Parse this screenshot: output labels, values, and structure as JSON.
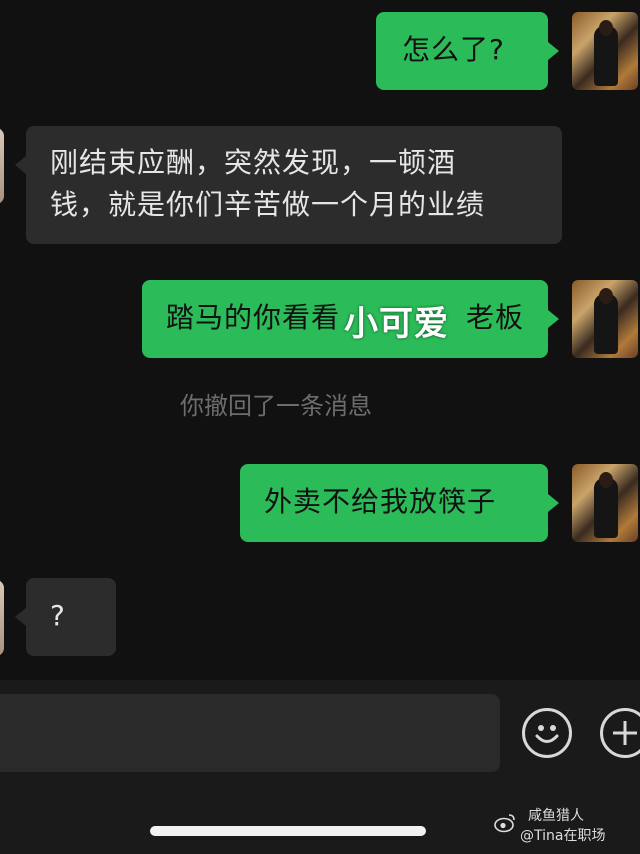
{
  "messages": [
    {
      "sender": "me",
      "text": "怎么了?"
    },
    {
      "sender": "them",
      "lines": [
        "刚结束应酬，突然发现，一顿酒",
        "钱，就是你们辛苦做一个月的业绩"
      ]
    },
    {
      "sender": "me",
      "text": "踏马的你看看",
      "text_tail": "老板"
    },
    {
      "sender": "me",
      "text": "外卖不给我放筷子"
    },
    {
      "sender": "them",
      "text": "?"
    }
  ],
  "overlay_text": "小可爱",
  "system_message": "你撤回了一条消息",
  "watermark": {
    "line1": "咸鱼猎人",
    "line2": "@Tina在职场"
  },
  "icons": {
    "emoji": "smiley-face-icon",
    "more": "plus-icon",
    "logo": "weibo-logo-icon"
  },
  "colors": {
    "my_bubble": "#2bbc59",
    "their_bubble": "#2c2c2c",
    "background": "#111111"
  }
}
